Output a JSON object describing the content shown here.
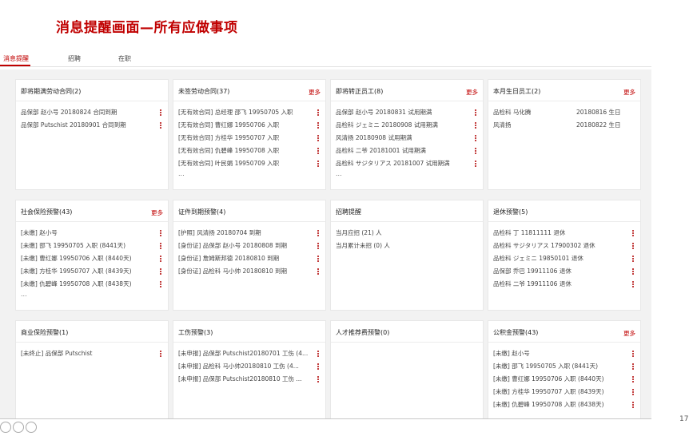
{
  "page_title": "消息提醒画面—所有应做事项",
  "tabs": [
    {
      "label": "消息提醒",
      "active": true
    },
    {
      "label": "招聘",
      "active": false
    },
    {
      "label": "在职",
      "active": false
    }
  ],
  "accent_color": "#c00000",
  "page_number": "17",
  "cards": [
    {
      "title": "即将期满劳动合同(2)",
      "more": "",
      "items": [
        "品保部 赵小号 20180824 合同到期",
        "品保部 Putschist 20180901 合同到期"
      ],
      "ellipsis": ""
    },
    {
      "title": "未签劳动合同(37)",
      "more": "更多",
      "items": [
        "[无有效合同] 总经理 邵飞 19950705 入职",
        "[无有效合同] 曹红娜 19950706 入职",
        "[无有效合同] 方桂华 19950707 入职",
        "[无有效合同] 仇碧峰 19950708 入职",
        "[无有效合同] 叶民娟 19950709 入职"
      ],
      "ellipsis": "..."
    },
    {
      "title": "即将转正员工(8)",
      "more": "更多",
      "items": [
        "品保部 赵小号 20180831 试用期满",
        "品检科 ジェミニ 20180908 试用期满",
        "风清扬 20180908 试用期满",
        "品检科 二爷 20181001 试用期满",
        "品检科 サジタリアス 20181007 试用期满"
      ],
      "ellipsis": "..."
    },
    {
      "title": "本月生日员工(2)",
      "more": "更多",
      "birthdays": [
        {
          "name": "品检科 马化腾",
          "date": "20180816 生日"
        },
        {
          "name": "风清扬",
          "date": "20180822 生日"
        }
      ]
    },
    {
      "title": "社会保险预警(43)",
      "more": "更多",
      "items": [
        "[未缴] 赵小号",
        "[未缴] 邵飞 19950705 入职 (8441天)",
        "[未缴] 曹红娜 19950706 入职 (8440天)",
        "[未缴] 方桂华 19950707 入职 (8439天)",
        "[未缴] 仇碧峰 19950708 入职 (8438天)"
      ],
      "ellipsis": "..."
    },
    {
      "title": "证件到期预警(4)",
      "more": "",
      "items": [
        "[护照] 风清扬 20180704 到期",
        "[身份证] 品保部 赵小号 20180808 到期",
        "[身份证] 詹姆斯邦德 20180810 到期",
        "[身份证] 品检科 马小帅 20180810 到期"
      ],
      "ellipsis": ""
    },
    {
      "title": "招聘提醒",
      "more": "",
      "items": [
        "当月应招 (21) 人",
        "当月累计未招 (0) 人"
      ],
      "ellipsis": ""
    },
    {
      "title": "退休预警(5)",
      "more": "",
      "items": [
        "品检科 丁 11811111 退休",
        "品检科 サジタリアス 17900302 退休",
        "品检科 ジェミニ 19850101 退休",
        "品保部 乔巴 19911106 退休",
        "品检科 二爷 19911106 退休"
      ],
      "ellipsis": ""
    },
    {
      "title": "商业保险预警(1)",
      "more": "",
      "items": [
        "[未终止] 品保部 Putschist"
      ],
      "ellipsis": ""
    },
    {
      "title": "工伤预警(3)",
      "more": "",
      "items": [
        "[未申报] 品保部 Putschist20180701 工伤 (4...",
        "[未申报] 品检科 马小帅20180810 工伤 (4...",
        "[未申报] 品保部 Putschist20180810 工伤 ..."
      ],
      "ellipsis": ""
    },
    {
      "title": "人才推荐费预警(0)",
      "more": "",
      "items": [],
      "ellipsis": ""
    },
    {
      "title": "公积金预警(43)",
      "more": "更多",
      "items": [
        "[未缴] 赵小号",
        "[未缴] 邵飞 19950705 入职 (8441天)",
        "[未缴] 曹红娜 19950706 入职 (8440天)",
        "[未缴] 方桂华 19950707 入职 (8439天)",
        "[未缴] 仇碧峰 19950708 入职 (8438天)"
      ],
      "ellipsis": ""
    }
  ]
}
